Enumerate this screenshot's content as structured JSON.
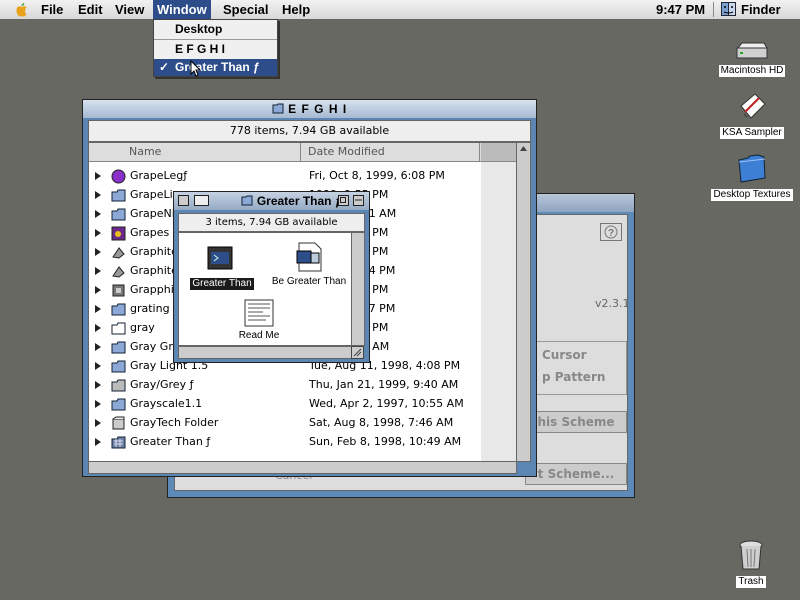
{
  "menubar": {
    "menus": [
      "File",
      "Edit",
      "View",
      "Window",
      "Special",
      "Help"
    ],
    "active_menu": "Window",
    "clock": "9:47 PM",
    "app_name": "Finder"
  },
  "window_menu": {
    "items": [
      {
        "label": "Desktop",
        "checked": false
      },
      {
        "label": "E F G H I",
        "checked": false
      },
      {
        "label": "Greater Than ƒ",
        "checked": true
      }
    ]
  },
  "desktop_icons": [
    {
      "label": "Macintosh HD",
      "icon": "hard-disk-icon"
    },
    {
      "label": "KSA Sampler",
      "icon": "document-icon"
    },
    {
      "label": "Desktop Textures",
      "icon": "blue-folder-icon"
    },
    {
      "label": "Trash",
      "icon": "trash-icon"
    }
  ],
  "efghi_window": {
    "title": "E F G H I",
    "status": "778 items, 7.94 GB available",
    "columns": {
      "name": "Name",
      "date": "Date Modified"
    },
    "rows": [
      {
        "name": "GrapeLegƒ",
        "date": "Fri, Oct 8, 1999, 6:08 PM",
        "icon": "purple-disc-icon"
      },
      {
        "name": "GrapeLin",
        "date": "1999, 9:55 PM",
        "icon": "folder-icon"
      },
      {
        "name": "GrapeNig",
        "date": "1998, 12:31 AM",
        "icon": "folder-icon"
      },
      {
        "name": "Grapes &",
        "date": "1998, 4:41 PM",
        "icon": "grapes-icon"
      },
      {
        "name": "Graphite",
        "date": "1999, 6:23 PM",
        "icon": "graphite-icon"
      },
      {
        "name": "Graphite",
        "date": "2000, 11:54 PM",
        "icon": "graphite-icon"
      },
      {
        "name": "Grapphir",
        "date": "2000, 1:18 PM",
        "icon": "app-icon"
      },
      {
        "name": "grating",
        "date": "1999, 12:17 PM",
        "icon": "folder-icon"
      },
      {
        "name": "gray",
        "date": "2000, 2:23 PM",
        "icon": "white-folder-icon"
      },
      {
        "name": "Gray Gro",
        "date": "1999, 4:57 AM",
        "icon": "folder-icon"
      },
      {
        "name": "Gray Light 1.5",
        "date": "Tue, Aug 11, 1998, 4:08 PM",
        "icon": "folder-icon"
      },
      {
        "name": "Gray/Grey ƒ",
        "date": "Thu, Jan 21, 1999, 9:40 AM",
        "icon": "gray-folder-icon"
      },
      {
        "name": "Grayscale1.1",
        "date": "Wed, Apr 2, 1997, 10:55 AM",
        "icon": "folder-icon"
      },
      {
        "name": "GrayTech Folder",
        "date": "Sat, Aug 8, 1998, 7:46 AM",
        "icon": "graytech-icon"
      },
      {
        "name": "Greater Than ƒ",
        "date": "Sun, Feb 8, 1998, 10:49 AM",
        "icon": "pattern-folder-icon"
      }
    ]
  },
  "greater_window": {
    "title": "Greater Than ƒ",
    "status": "3 items, 7.94 GB available",
    "items": [
      {
        "label": "Greater Than",
        "selected": true
      },
      {
        "label": "Be Greater Than",
        "selected": false
      },
      {
        "label": "Read Me",
        "selected": false
      }
    ]
  },
  "back_window": {
    "version": "v2.3.1",
    "labels": [
      "Cursor",
      "p Pattern",
      "his Scheme",
      "t Scheme...",
      "Cancel"
    ]
  }
}
